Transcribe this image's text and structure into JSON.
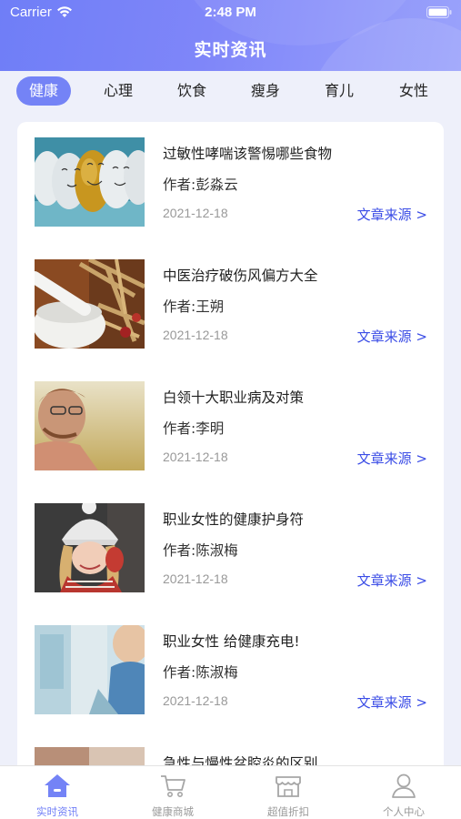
{
  "status_bar": {
    "carrier": "Carrier",
    "time": "2:48 PM"
  },
  "header": {
    "title": "实时资讯"
  },
  "tabs": [
    {
      "label": "健康",
      "active": true
    },
    {
      "label": "心理",
      "active": false
    },
    {
      "label": "饮食",
      "active": false
    },
    {
      "label": "瘦身",
      "active": false
    },
    {
      "label": "育儿",
      "active": false
    },
    {
      "label": "女性",
      "active": false
    }
  ],
  "articles": [
    {
      "title": "过敏性哮喘该警惕哪些食物",
      "author": "作者:彭淼云",
      "date": "2021-12-18",
      "source": "文章来源 >",
      "image": "eggs-faces-image"
    },
    {
      "title": "中医治疗破伤风偏方大全",
      "author": "作者:王朔",
      "date": "2021-12-18",
      "source": "文章来源 >",
      "image": "herbs-mortar-image"
    },
    {
      "title": "白领十大职业病及对策",
      "author": "作者:李明",
      "date": "2021-12-18",
      "source": "文章来源 >",
      "image": "man-glasses-image"
    },
    {
      "title": "职业女性的健康护身符",
      "author": "作者:陈淑梅",
      "date": "2021-12-18",
      "source": "文章来源 >",
      "image": "woman-winter-hat-image"
    },
    {
      "title": "职业女性 给健康充电!",
      "author": "作者:陈淑梅",
      "date": "2021-12-18",
      "source": "文章来源 >",
      "image": "office-blur-image"
    },
    {
      "title": "急性与慢性盆腔炎的区别",
      "author": "",
      "date": "",
      "source": "",
      "image": "partial-image"
    }
  ],
  "tabbar": [
    {
      "label": "实时资讯",
      "icon": "home-icon",
      "active": true
    },
    {
      "label": "健康商城",
      "icon": "cart-icon",
      "active": false
    },
    {
      "label": "超值折扣",
      "icon": "store-icon",
      "active": false
    },
    {
      "label": "个人中心",
      "icon": "user-icon",
      "active": false
    }
  ],
  "colors": {
    "accent": "#7483f6",
    "link": "#3a4ce6",
    "background": "#eef0fa"
  }
}
